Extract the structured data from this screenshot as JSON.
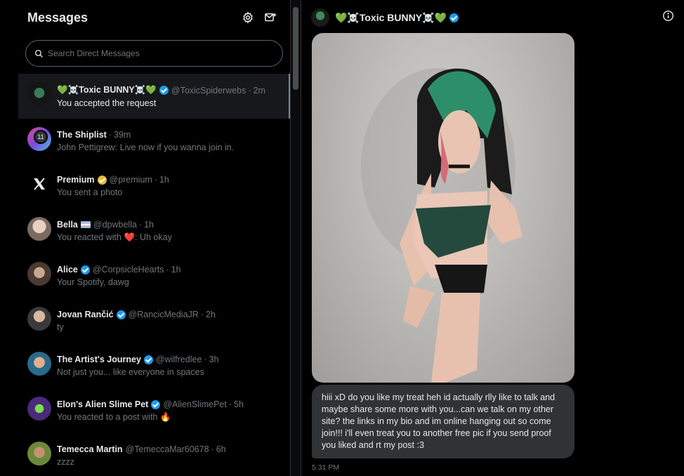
{
  "sidebar": {
    "title": "Messages",
    "settings_icon": "gear-icon",
    "compose_icon": "new-message-icon",
    "search_placeholder": "Search Direct Messages"
  },
  "conversations": [
    {
      "name": "💚☠️Toxic BUNNY☠️💚",
      "verified": "blue",
      "handle": "@ToxicSpiderwebs",
      "time": "2m",
      "preview": "You accepted the request",
      "active": true
    },
    {
      "name": "The Shiplist",
      "handle": "",
      "time": "39m",
      "preview": "John Pettigrew: Live now if you wanna join in.",
      "badge": "11"
    },
    {
      "name": "Premium",
      "verified": "gold",
      "handle": "@premium",
      "time": "1h",
      "preview": "You sent a photo"
    },
    {
      "name": "Bella",
      "handle": "@dpwbella",
      "time": "1h",
      "preview_prefix": "You reacted with ",
      "preview_emoji": "❤️",
      "preview_suffix": ": Uh okay"
    },
    {
      "name": "Alice",
      "verified": "blue",
      "handle": "@CorpsicleHearts",
      "time": "1h",
      "preview": "Your Spotify, dawg"
    },
    {
      "name": "Jovan Rančić",
      "verified": "blue",
      "handle": "@RancicMediaJR",
      "time": "2h",
      "preview": "ty"
    },
    {
      "name": "The Artist's Journey",
      "verified": "blue",
      "handle": "@wilfredlee",
      "time": "3h",
      "preview": "Not just you... like everyone in spaces"
    },
    {
      "name": "Elon's Alien Slime Pet",
      "verified": "blue",
      "handle": "@AlienSlimePet",
      "time": "5h",
      "preview": "You reacted to a post with 🔥"
    },
    {
      "name": "Temecca Martin",
      "handle": "@TemeccaMar60678",
      "time": "6h",
      "preview": "zzzz"
    }
  ],
  "chat": {
    "name": "💚☠️Toxic BUNNY☠️💚",
    "info_icon": "info-icon",
    "message": "hiii xD do you like my treat heh id actually rlly like to talk and maybe share some more with you...can we talk on my other site? the links in my bio and im online hanging out so come join!!! i'll even treat you to another free pic if you send proof you liked and rt my post :3",
    "time": "5:31 PM"
  },
  "colors": {
    "background": "#000000",
    "text": "#e7e9ea",
    "muted": "#71767b",
    "verified_blue": "#1d9bf0",
    "verified_gold": "#e8b93b",
    "bubble": "#2f3336"
  }
}
